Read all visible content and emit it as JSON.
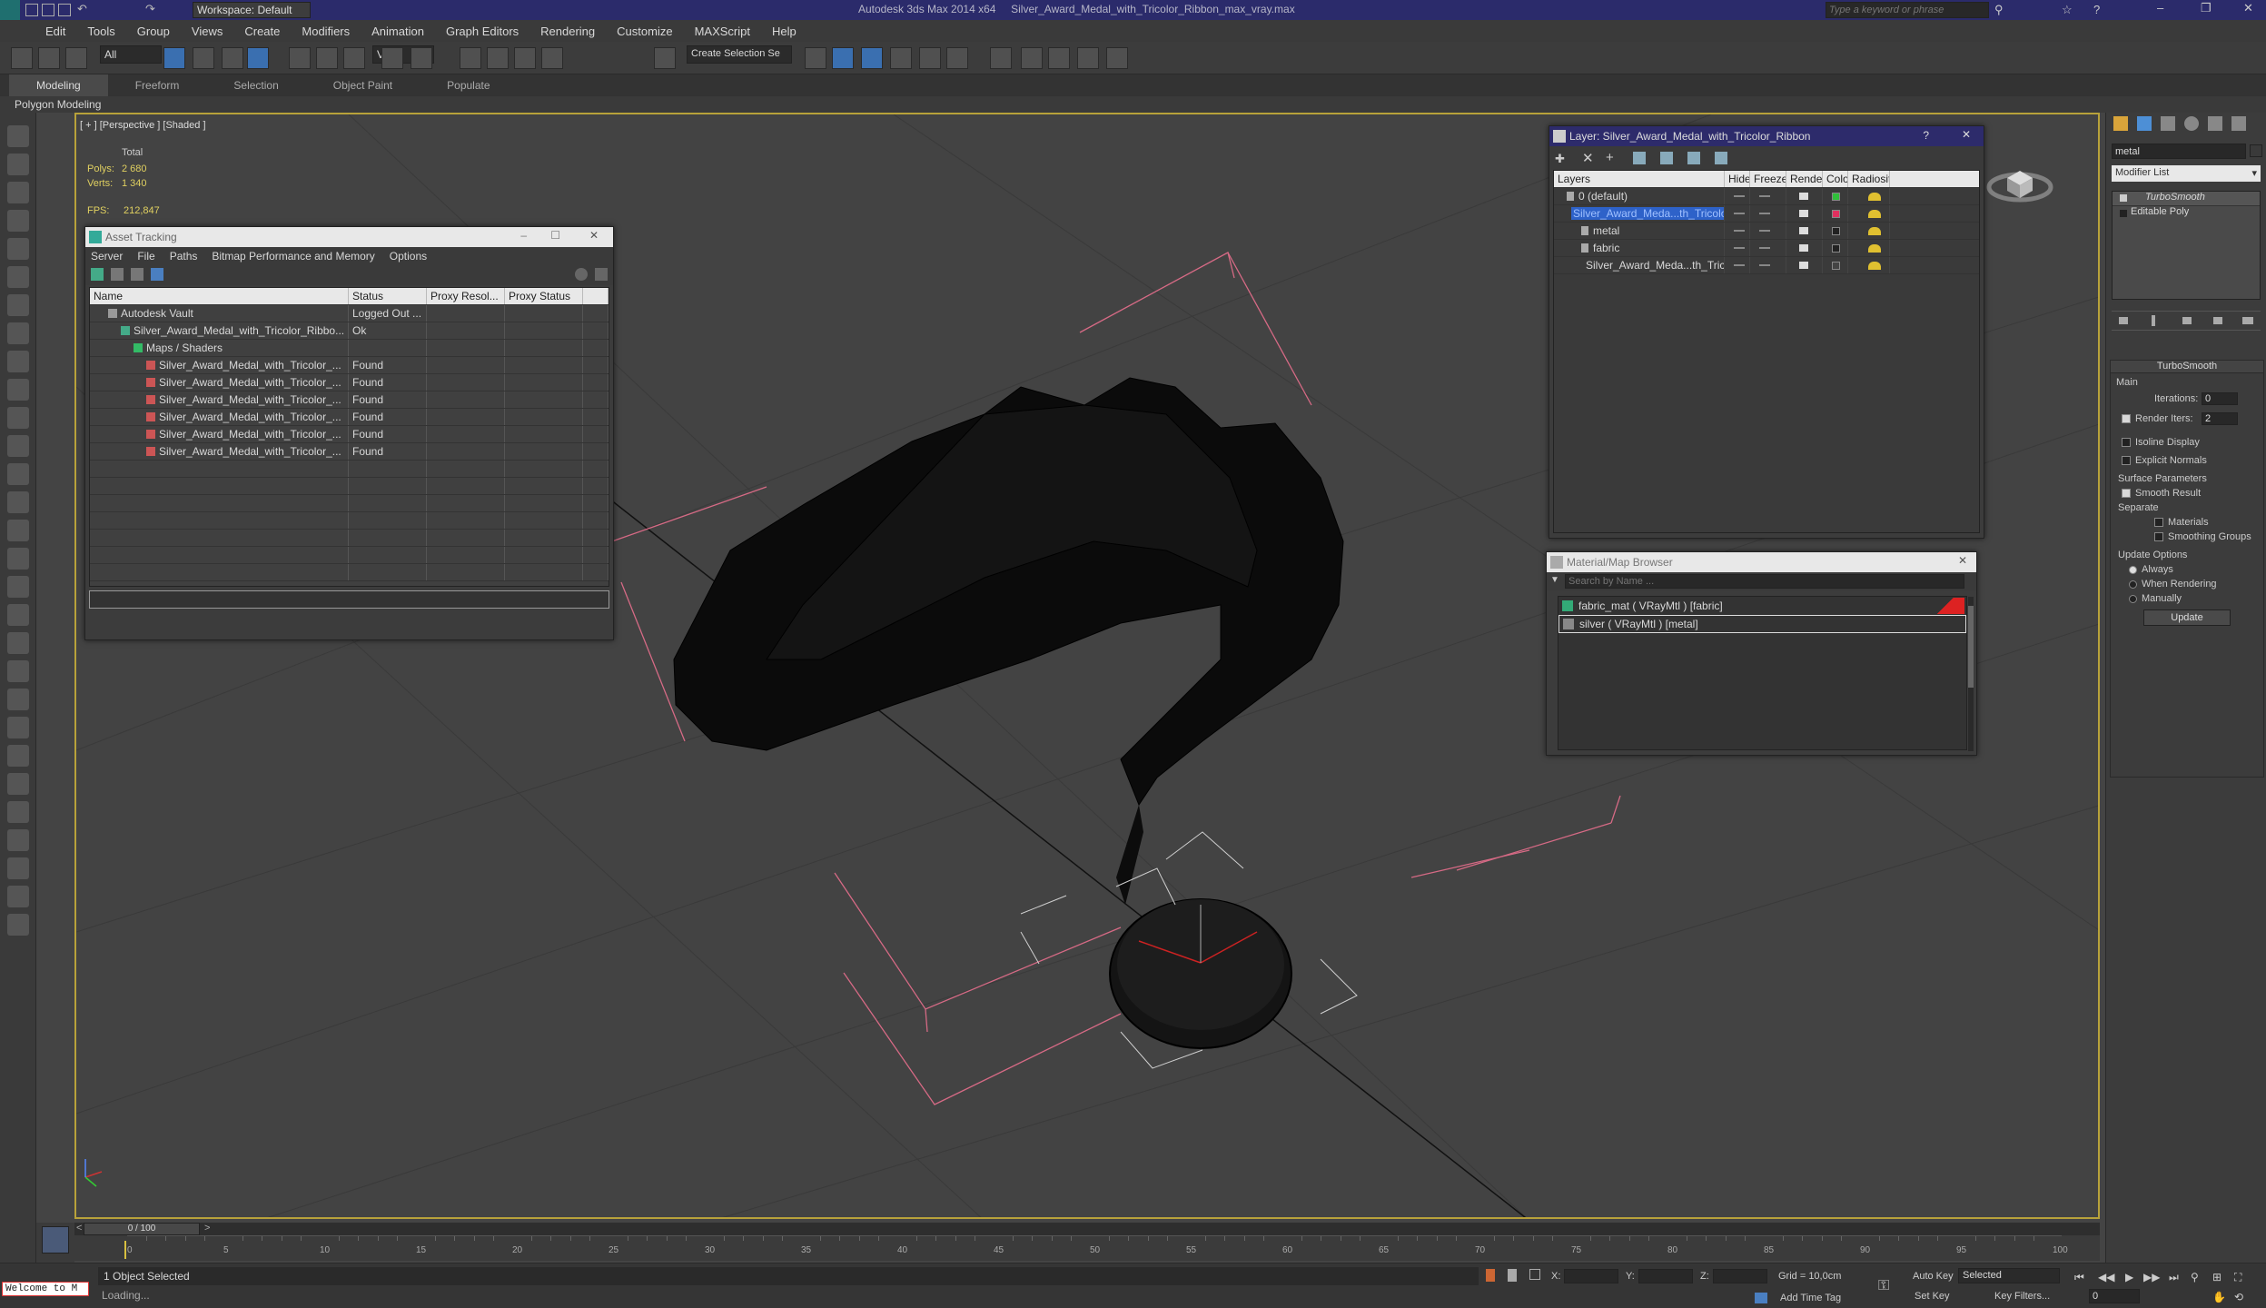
{
  "title": {
    "workspace": "Workspace: Default",
    "app": "Autodesk 3ds Max  2014 x64",
    "file": "Silver_Award_Medal_with_Tricolor_Ribbon_max_vray.max",
    "search_placeholder": "Type a keyword or phrase"
  },
  "menu": [
    "Edit",
    "Tools",
    "Group",
    "Views",
    "Create",
    "Modifiers",
    "Animation",
    "Graph Editors",
    "Rendering",
    "Customize",
    "MAXScript",
    "Help"
  ],
  "toolbar": {
    "filter": "All",
    "refcoord": "View",
    "selection_set": "Create Selection Se"
  },
  "ribbon": {
    "tabs": [
      "Modeling",
      "Freeform",
      "Selection",
      "Object Paint",
      "Populate"
    ],
    "sub": "Polygon Modeling"
  },
  "viewport": {
    "label": "[ + ] [Perspective ] [Shaded ]",
    "stats_total": "Total",
    "polys_label": "Polys:",
    "polys": "2 680",
    "verts_label": "Verts:",
    "verts": "1 340",
    "fps_label": "FPS:",
    "fps": "212,847"
  },
  "asset_tracking": {
    "title": "Asset Tracking",
    "menu": [
      "Server",
      "File",
      "Paths",
      "Bitmap Performance and Memory",
      "Options"
    ],
    "columns": [
      "Name",
      "Status",
      "Proxy Resol...",
      "Proxy Status"
    ],
    "rows": [
      {
        "name": "Autodesk Vault",
        "status": "Logged Out ...",
        "indent": 0
      },
      {
        "name": "Silver_Award_Medal_with_Tricolor_Ribbo...",
        "status": "Ok",
        "indent": 1
      },
      {
        "name": "Maps / Shaders",
        "status": "",
        "indent": 2
      },
      {
        "name": "Silver_Award_Medal_with_Tricolor_...",
        "status": "Found",
        "indent": 3
      },
      {
        "name": "Silver_Award_Medal_with_Tricolor_...",
        "status": "Found",
        "indent": 3
      },
      {
        "name": "Silver_Award_Medal_with_Tricolor_...",
        "status": "Found",
        "indent": 3
      },
      {
        "name": "Silver_Award_Medal_with_Tricolor_...",
        "status": "Found",
        "indent": 3
      },
      {
        "name": "Silver_Award_Medal_with_Tricolor_...",
        "status": "Found",
        "indent": 3
      },
      {
        "name": "Silver_Award_Medal_with_Tricolor_...",
        "status": "Found",
        "indent": 3
      }
    ]
  },
  "layer_manager": {
    "title": "Layer: Silver_Award_Medal_with_Tricolor_Ribbon",
    "help": "?",
    "columns": [
      "Layers",
      "Hide",
      "Freeze",
      "Render",
      "Color",
      "Radiosity"
    ],
    "rows": [
      {
        "name": "0 (default)",
        "indent": 0,
        "selected": false,
        "color": "#2fbf3a"
      },
      {
        "name": "Silver_Award_Meda...th_Tricolor_R",
        "indent": 0,
        "selected": true,
        "color": "#e0305f"
      },
      {
        "name": "metal",
        "indent": 1,
        "selected": false,
        "color": "#222222"
      },
      {
        "name": "fabric",
        "indent": 1,
        "selected": false,
        "color": "#222222"
      },
      {
        "name": "Silver_Award_Meda...th_Tricolo",
        "indent": 1,
        "selected": false,
        "color": "#444444"
      }
    ]
  },
  "material_browser": {
    "title": "Material/Map Browser",
    "search_placeholder": "Search by Name ...",
    "items": [
      "fabric_mat  ( VRayMtl )  [fabric]",
      "silver  ( VRayMtl )  [metal]"
    ]
  },
  "command_panel": {
    "name_field": "metal",
    "modifier_list": "Modifier List",
    "stack": [
      "TurboSmooth",
      "Editable Poly"
    ],
    "rollout_title": "TurboSmooth",
    "main_label": "Main",
    "iterations_label": "Iterations:",
    "iterations": "0",
    "render_iters_label": "Render Iters:",
    "render_iters": "2",
    "isoline": "Isoline Display",
    "explicit": "Explicit Normals",
    "surface_params": "Surface Parameters",
    "smooth_result": "Smooth Result",
    "separate": "Separate",
    "materials": "Materials",
    "smoothing_groups": "Smoothing Groups",
    "update_options": "Update Options",
    "always": "Always",
    "when_rendering": "When Rendering",
    "manually": "Manually",
    "update_btn": "Update"
  },
  "timeline": {
    "frame": "0 / 100",
    "ticks": [
      "0",
      "5",
      "10",
      "15",
      "20",
      "25",
      "30",
      "35",
      "40",
      "45",
      "50",
      "55",
      "60",
      "65",
      "70",
      "75",
      "80",
      "85",
      "90",
      "95",
      "100"
    ]
  },
  "status": {
    "welcome": "Welcome to M",
    "selected": "1 Object Selected",
    "loading": "Loading...",
    "x_label": "X:",
    "y_label": "Y:",
    "z_label": "Z:",
    "grid": "Grid = 10,0cm",
    "add_time_tag": "Add Time Tag",
    "auto_key": "Auto Key",
    "set_key": "Set Key",
    "key_mode": "Selected",
    "key_filters": "Key Filters...",
    "frame_field": "0"
  }
}
